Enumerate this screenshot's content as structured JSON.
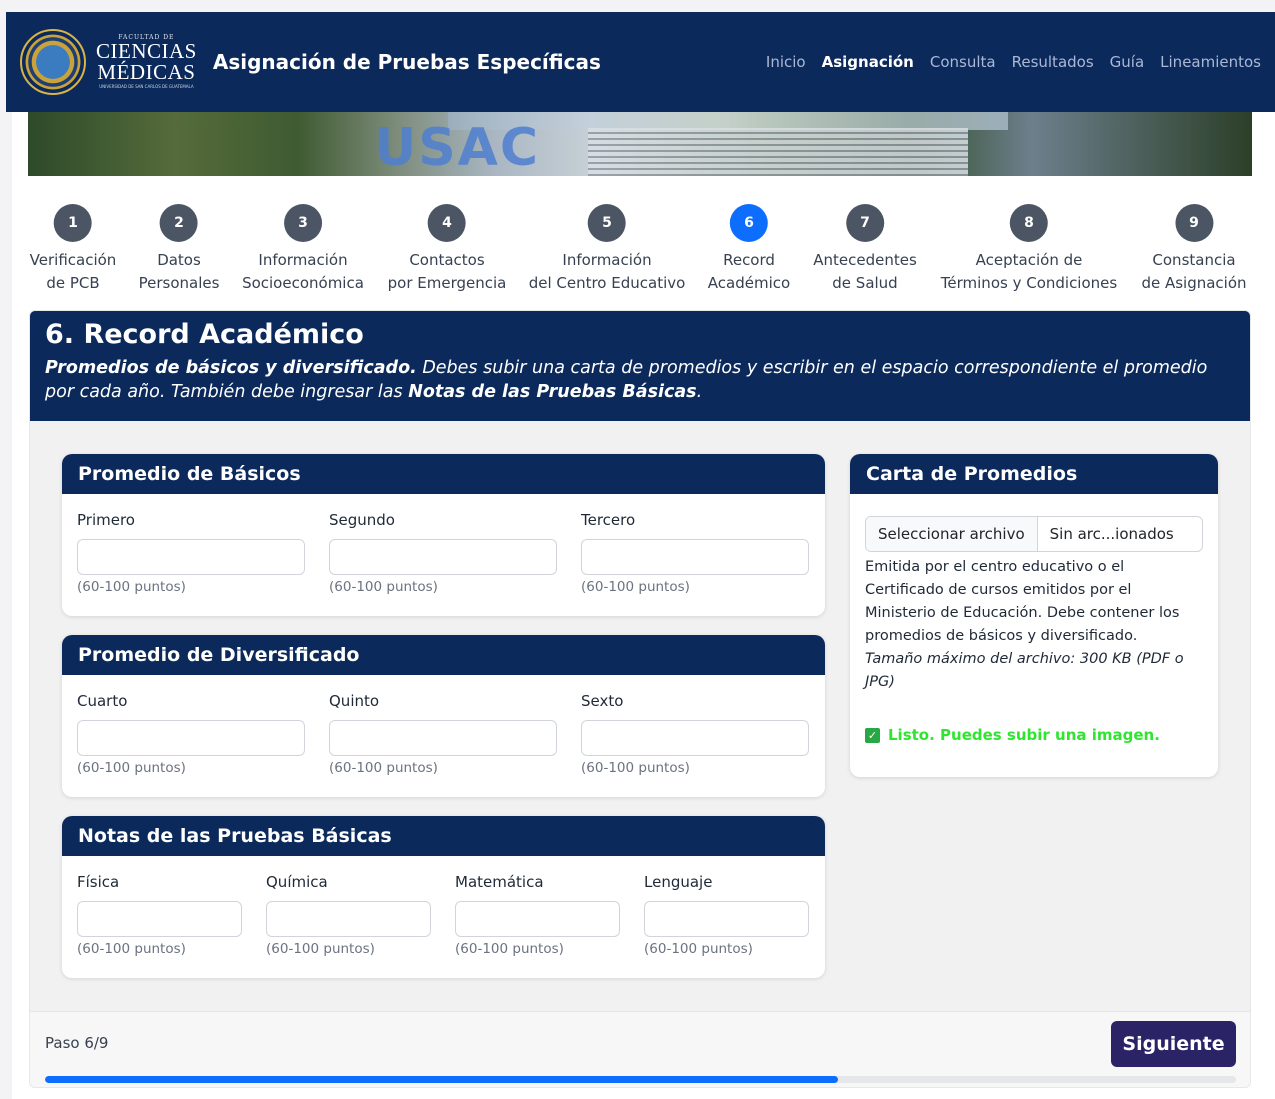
{
  "navbar": {
    "logo": {
      "small_text": "FACULTAD DE",
      "line1": "CIENCIAS",
      "line2": "MÉDICAS",
      "tiny_text": "UNIVERSIDAD DE SAN CARLOS DE GUATEMALA"
    },
    "title": "Asignación de Pruebas Específicas",
    "links": [
      {
        "label": "Inicio",
        "active": false
      },
      {
        "label": "Asignación",
        "active": true
      },
      {
        "label": "Consulta",
        "active": false
      },
      {
        "label": "Resultados",
        "active": false
      },
      {
        "label": "Guía",
        "active": false
      },
      {
        "label": "Lineamientos",
        "active": false
      }
    ]
  },
  "banner": {
    "text": "USAC"
  },
  "stepper": {
    "steps": [
      {
        "num": "1",
        "line1": "Verificación",
        "line2": "de PCB",
        "active": false
      },
      {
        "num": "2",
        "line1": "Datos",
        "line2": "Personales",
        "active": false
      },
      {
        "num": "3",
        "line1": "Información",
        "line2": "Socioeconómica",
        "active": false
      },
      {
        "num": "4",
        "line1": "Contactos",
        "line2": "por Emergencia",
        "active": false
      },
      {
        "num": "5",
        "line1": "Información",
        "line2": "del Centro Educativo",
        "active": false
      },
      {
        "num": "6",
        "line1": "Record",
        "line2": "Académico",
        "active": true
      },
      {
        "num": "7",
        "line1": "Antecedentes",
        "line2": "de Salud",
        "active": false
      },
      {
        "num": "8",
        "line1": "Aceptación de",
        "line2": "Términos y Condiciones",
        "active": false
      },
      {
        "num": "9",
        "line1": "Constancia",
        "line2": "de Asignación",
        "active": false
      }
    ]
  },
  "main": {
    "title": "6. Record Académico",
    "desc_bold1": "Promedios de básicos y diversificado.",
    "desc_text1": " Debes subir una carta de promedios y escribir en el espacio correspondiente el promedio por cada año. También debe ingresar las ",
    "desc_bold2": "Notas de las Pruebas Básicas",
    "desc_text2": "."
  },
  "basicos": {
    "title": "Promedio de Básicos",
    "fields": [
      {
        "label": "Primero",
        "value": "",
        "hint": "(60-100 puntos)"
      },
      {
        "label": "Segundo",
        "value": "",
        "hint": "(60-100 puntos)"
      },
      {
        "label": "Tercero",
        "value": "",
        "hint": "(60-100 puntos)"
      }
    ]
  },
  "diversificado": {
    "title": "Promedio de Diversificado",
    "fields": [
      {
        "label": "Cuarto",
        "value": "",
        "hint": "(60-100 puntos)"
      },
      {
        "label": "Quinto",
        "value": "",
        "hint": "(60-100 puntos)"
      },
      {
        "label": "Sexto",
        "value": "",
        "hint": "(60-100 puntos)"
      }
    ]
  },
  "pruebas": {
    "title": "Notas de las Pruebas Básicas",
    "fields": [
      {
        "label": "Física",
        "value": "",
        "hint": "(60-100 puntos)"
      },
      {
        "label": "Química",
        "value": "",
        "hint": "(60-100 puntos)"
      },
      {
        "label": "Matemática",
        "value": "",
        "hint": "(60-100 puntos)"
      },
      {
        "label": "Lenguaje",
        "value": "",
        "hint": "(60-100 puntos)"
      }
    ]
  },
  "carta": {
    "title": "Carta de Promedios",
    "file_button": "Seleccionar archivo",
    "file_name": "Sin arc...ionados",
    "description": "Emitida por el centro educativo o el Certificado de cursos emitidos por el Ministerio de Educación. Debe contener los promedios de básicos y diversificado.",
    "size_note": "Tamaño máximo del archivo: 300 KB (PDF o JPG)",
    "status": "Listo. Puedes subir una imagen.",
    "status_color": "#2ee62e"
  },
  "footer": {
    "step_text": "Paso 6/9",
    "next_label": "Siguiente",
    "progress": 0.666
  },
  "colors": {
    "primary": "#0b2a5b",
    "active_step": "#0d6efd",
    "inactive_step": "#4b5563",
    "next_button": "#2a2366"
  }
}
